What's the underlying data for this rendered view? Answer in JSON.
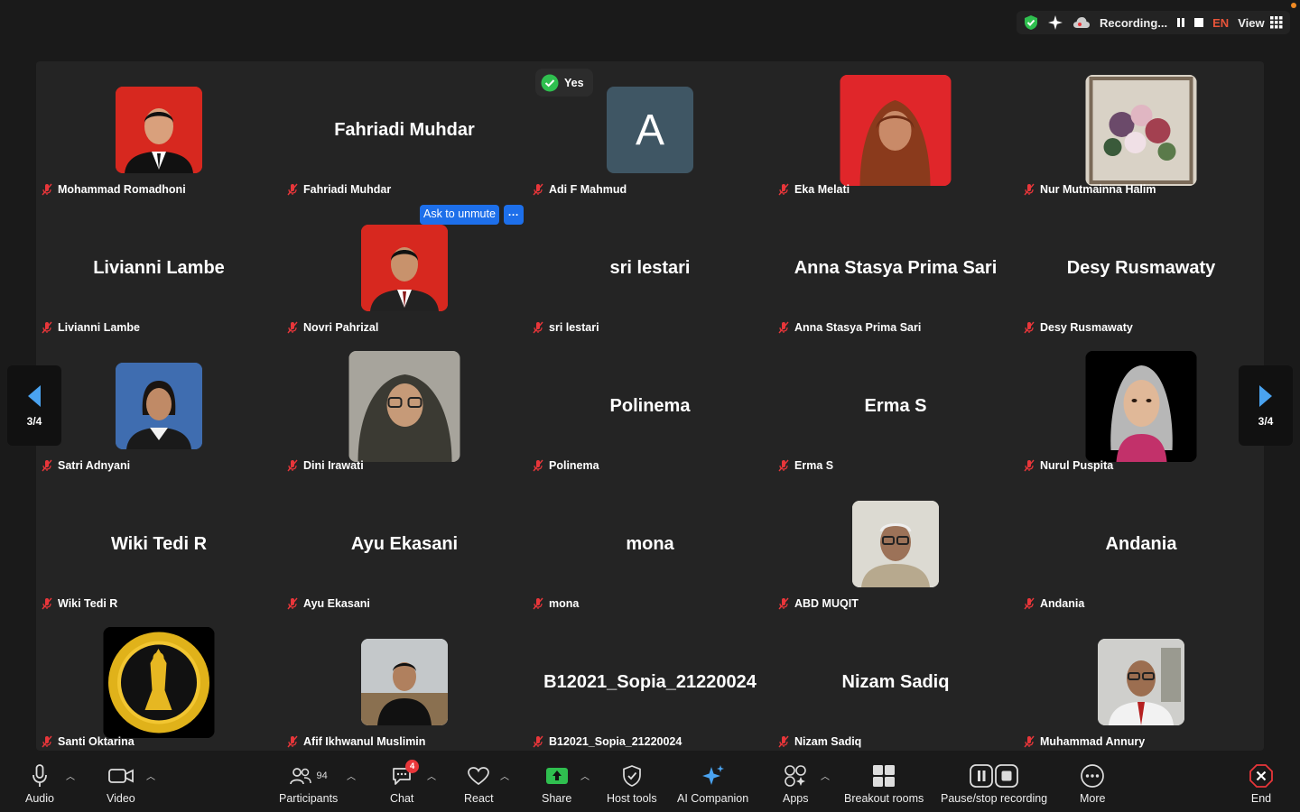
{
  "status": {
    "recording_label": "Recording...",
    "language": "EN",
    "view_label": "View"
  },
  "reaction": {
    "label": "Yes"
  },
  "ask_unmute": {
    "label": "Ask to unmute",
    "more": "···"
  },
  "pager": {
    "left": "3/4",
    "right": "3/4"
  },
  "tiles": [
    {
      "label": "Mohammad Romadhoni",
      "big": ""
    },
    {
      "label": "Fahriadi Muhdar",
      "big": "Fahriadi Muhdar"
    },
    {
      "label": "Adi F Mahmud",
      "big": "",
      "avatar_letter": "A"
    },
    {
      "label": "Eka Melati",
      "big": ""
    },
    {
      "label": "Nur Mutmainna Halim",
      "big": ""
    },
    {
      "label": "Livianni Lambe",
      "big": "Livianni Lambe"
    },
    {
      "label": "Novri Pahrizal",
      "big": ""
    },
    {
      "label": "sri lestari",
      "big": "sri lestari"
    },
    {
      "label": "Anna Stasya Prima Sari",
      "big": "Anna Stasya Prima Sari"
    },
    {
      "label": "Desy Rusmawaty",
      "big": "Desy Rusmawaty"
    },
    {
      "label": "Satri Adnyani",
      "big": ""
    },
    {
      "label": "Dini Irawati",
      "big": ""
    },
    {
      "label": "Polinema",
      "big": "Polinema"
    },
    {
      "label": "Erma S",
      "big": "Erma S"
    },
    {
      "label": "Nurul Puspita",
      "big": ""
    },
    {
      "label": "Wiki Tedi R",
      "big": "Wiki Tedi R"
    },
    {
      "label": "Ayu Ekasani",
      "big": "Ayu Ekasani"
    },
    {
      "label": "mona",
      "big": "mona"
    },
    {
      "label": "ABD MUQIT",
      "big": ""
    },
    {
      "label": "Andania",
      "big": "Andania"
    },
    {
      "label": "Santi Oktarina",
      "big": ""
    },
    {
      "label": "Afif Ikhwanul Muslimin",
      "big": ""
    },
    {
      "label": "B12021_Sopia_21220024",
      "big": "B12021_Sopia_21220024"
    },
    {
      "label": "Nizam Sadiq",
      "big": "Nizam Sadiq"
    },
    {
      "label": "Muhammad Annury",
      "big": ""
    }
  ],
  "toolbar": {
    "audio": "Audio",
    "video": "Video",
    "participants": "Participants",
    "participants_count": "94",
    "chat": "Chat",
    "chat_badge": "4",
    "react": "React",
    "share": "Share",
    "host_tools": "Host tools",
    "ai_companion": "AI Companion",
    "apps": "Apps",
    "breakout": "Breakout rooms",
    "recording": "Pause/stop recording",
    "more": "More",
    "end": "End"
  },
  "colors": {
    "accent_blue": "#1d6fea",
    "share_green": "#2fbf4f",
    "end_red": "#e8363a",
    "record_orange": "#e8543a",
    "tile_bg": "#242424"
  }
}
